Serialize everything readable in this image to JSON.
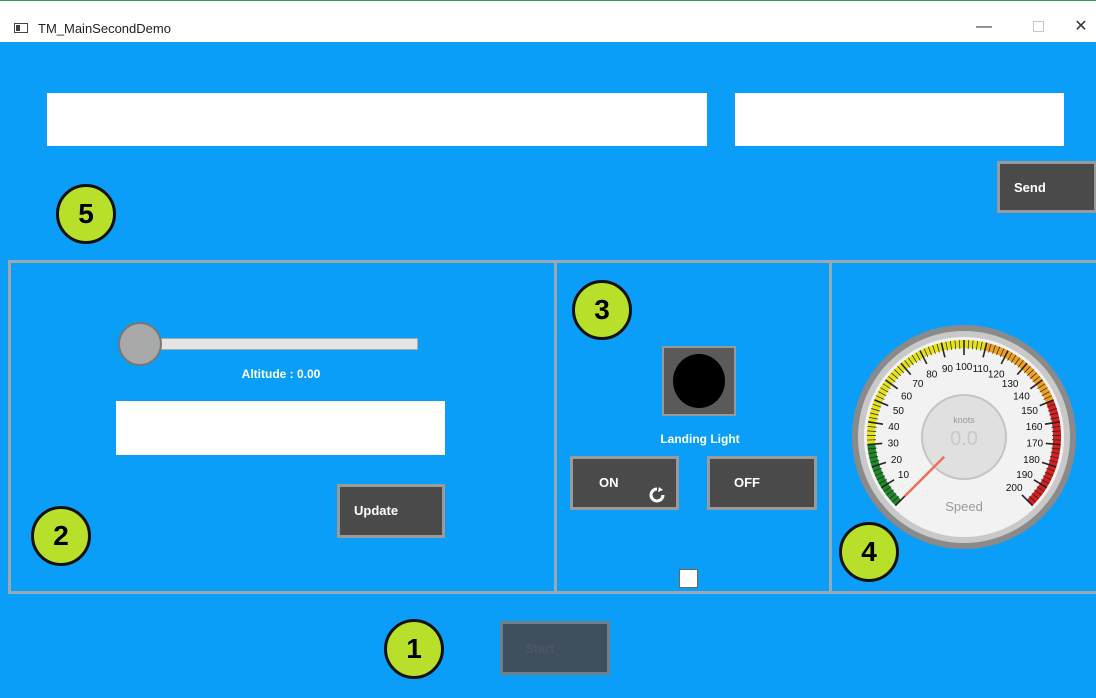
{
  "window": {
    "title": "TM_MainSecondDemo",
    "minimize_glyph": "—",
    "close_glyph": "✕"
  },
  "section5": {
    "badge": "5",
    "message_input": {
      "value": "",
      "placeholder": ""
    },
    "target_input": {
      "value": "",
      "placeholder": ""
    },
    "send_label": "Send"
  },
  "section2": {
    "badge": "2",
    "altitude_label": "Altitude : 0.00",
    "altitude_slider_fraction": 0,
    "altitude_input": {
      "value": "",
      "placeholder": ""
    },
    "update_label": "Update"
  },
  "section3": {
    "badge": "3",
    "light_label": "Landing Light",
    "light_state_color": "#000000",
    "on_label": "ON",
    "off_label": "OFF"
  },
  "section4": {
    "badge": "4",
    "gauge": {
      "unit": "knots",
      "value_text": "0.0",
      "caption": "Speed",
      "value": 0,
      "min": 0,
      "max": 200,
      "major_ticks": [
        10,
        20,
        30,
        40,
        50,
        60,
        70,
        80,
        90,
        100,
        110,
        120,
        130,
        140,
        150,
        160,
        170,
        180,
        190,
        200
      ]
    }
  },
  "section1": {
    "badge": "1",
    "start_label": "Start"
  },
  "colors": {
    "background": "#0a9ef8",
    "button": "#4a4a4a",
    "badge": "#b8e02a",
    "gauge_green": "#1e8a2a",
    "gauge_yellow": "#e6e21a",
    "gauge_orange": "#f0a020",
    "gauge_red": "#d42020"
  }
}
